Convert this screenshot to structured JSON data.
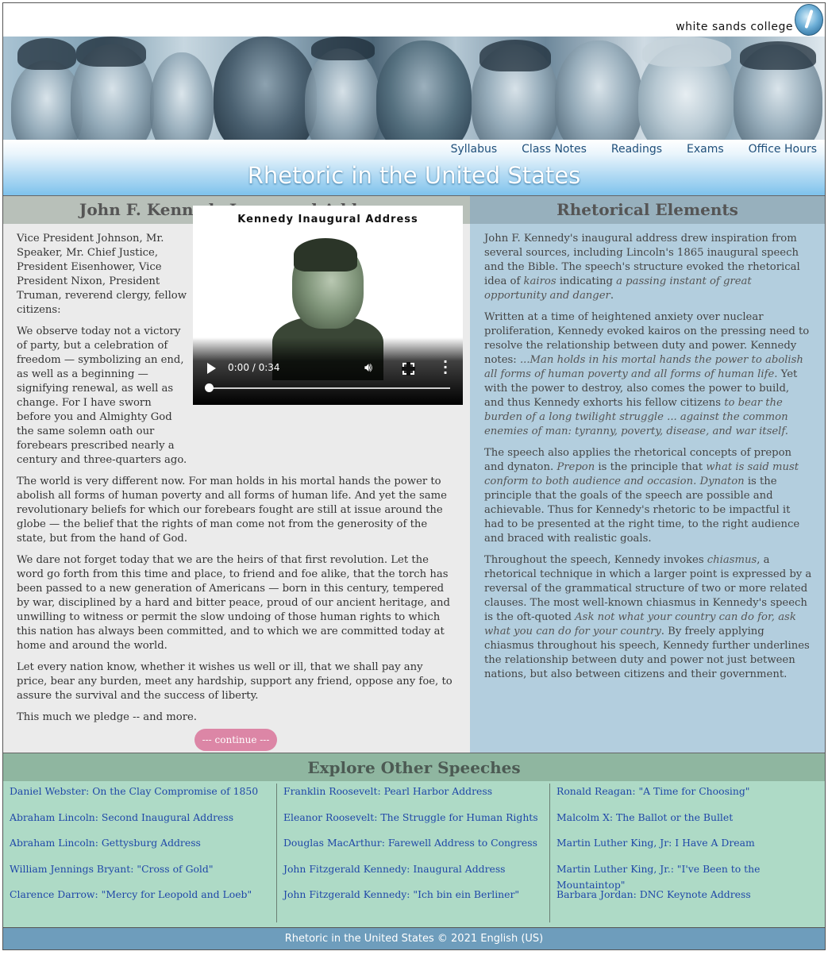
{
  "header": {
    "logo_text": "white sands college",
    "site_title": "Rhetoric in the United States"
  },
  "nav": [
    "Syllabus",
    "Class Notes",
    "Readings",
    "Exams",
    "Office Hours"
  ],
  "speech": {
    "heading": "John F. Kennedy Inaugural Address",
    "video_title": "Kennedy Inaugural Address",
    "video_time": "0:00 / 0:34",
    "paragraphs": [
      "Vice President Johnson, Mr. Speaker, Mr. Chief Justice, President Eisenhower, Vice President Nixon, President Truman, reverend clergy, fellow citizens:",
      "We observe today not a victory of party, but a celebration of freedom — symbolizing an end, as well as a beginning — signifying renewal, as well as change. For I have sworn before you and Almighty God the same solemn oath our forebears prescribed nearly a century and three-quarters ago.",
      "The world is very different now. For man holds in his mortal hands the power to abolish all forms of human poverty and all forms of human life. And yet the same revolutionary beliefs for which our forebears fought are still at issue around the globe — the belief that the rights of man come not from the generosity of the state, but from the hand of God.",
      "We dare not forget today that we are the heirs of that first revolution. Let the word go forth from this time and place, to friend and foe alike, that the torch has been passed to a new generation of Americans — born in this century, tempered by war, disciplined by a hard and bitter peace, proud of our ancient heritage, and unwilling to witness or permit the slow undoing of those human rights to which this nation has always been committed, and to which we are committed today at home and around the world.",
      "Let every nation know, whether it wishes us well or ill, that we shall pay any price, bear any burden, meet any hardship, support any friend, oppose any foe, to assure the survival and the success of liberty.",
      "This much we pledge -- and more."
    ],
    "continue_label": "--- continue ---"
  },
  "elements": {
    "heading": "Rhetorical Elements",
    "p1": {
      "a": "John F. Kennedy's inaugural address drew inspiration from several sources, including Lincoln's 1865 inaugural speech and the Bible. The speech's structure evoked the rhetorical idea of ",
      "b": "kairos",
      "c": " indicating ",
      "d": "a passing instant of great opportunity and danger",
      "e": "."
    },
    "p2": {
      "a": "Written at a time of heightened anxiety over nuclear proliferation, Kennedy evoked kairos on the pressing need to resolve the relationship between duty and power. Kennedy notes: ",
      "b": "...Man holds in his mortal hands the power to abolish all forms of human poverty and all forms of human life.",
      "c": " Yet with the power to destroy, also comes the power to build, and thus Kennedy exhorts his fellow citizens ",
      "d": "to bear the burden of a long twilight struggle ... against the common enemies of man: tyranny, poverty, disease, and war itself."
    },
    "p3": {
      "a": "The speech also applies the rhetorical concepts of prepon and dynaton. ",
      "b": "Prepon",
      "c": " is the principle that ",
      "d": "what is said must conform to both audience and occasion.",
      "e": " ",
      "f": "Dynaton",
      "g": " is the principle that the goals of the speech are possible and achievable. Thus for Kennedy's rhetoric to be impactful it had to be presented at the right time, to the right audience and braced with realistic goals."
    },
    "p4": {
      "a": "Throughout the speech, Kennedy invokes ",
      "b": "chiasmus",
      "c": ", a rhetorical technique in which a larger point is expressed by a reversal of the grammatical structure of two or more related clauses. The most well-known chiasmus in Kennedy's speech is the oft-quoted ",
      "d": "Ask not what your country can do for, ask what you can do for your country",
      "e": ". By freely applying chiasmus throughout his speech, Kennedy further underlines the relationship between duty and power not just between nations, but also between citizens and their government."
    }
  },
  "explore": {
    "heading": "Explore Other Speeches",
    "col1": [
      "Daniel Webster: On the Clay Compromise of 1850",
      "Abraham Lincoln: Second Inaugural Address",
      "Abraham Lincoln: Gettysburg Address",
      "William Jennings Bryant: \"Cross of Gold\"",
      "Clarence Darrow: \"Mercy for Leopold and Loeb\""
    ],
    "col2": [
      "Franklin Roosevelt: Pearl Harbor Address",
      "Eleanor Roosevelt: The Struggle for Human Rights",
      "Douglas MacArthur: Farewell Address to Congress",
      "John Fitzgerald Kennedy: Inaugural Address",
      "John Fitzgerald Kennedy: \"Ich bin ein Berliner\""
    ],
    "col3": [
      "Ronald Reagan: \"A Time for Choosing\"",
      "Malcolm X: The Ballot or the Bullet",
      "Martin Luther King, Jr: I Have A Dream",
      "Martin Luther King, Jr.: \"I've Been to the Mountaintop\"",
      "Barbara Jordan: DNC Keynote Address"
    ]
  },
  "footer": {
    "text": "Rhetoric in the United States © 2021 English (US)"
  }
}
